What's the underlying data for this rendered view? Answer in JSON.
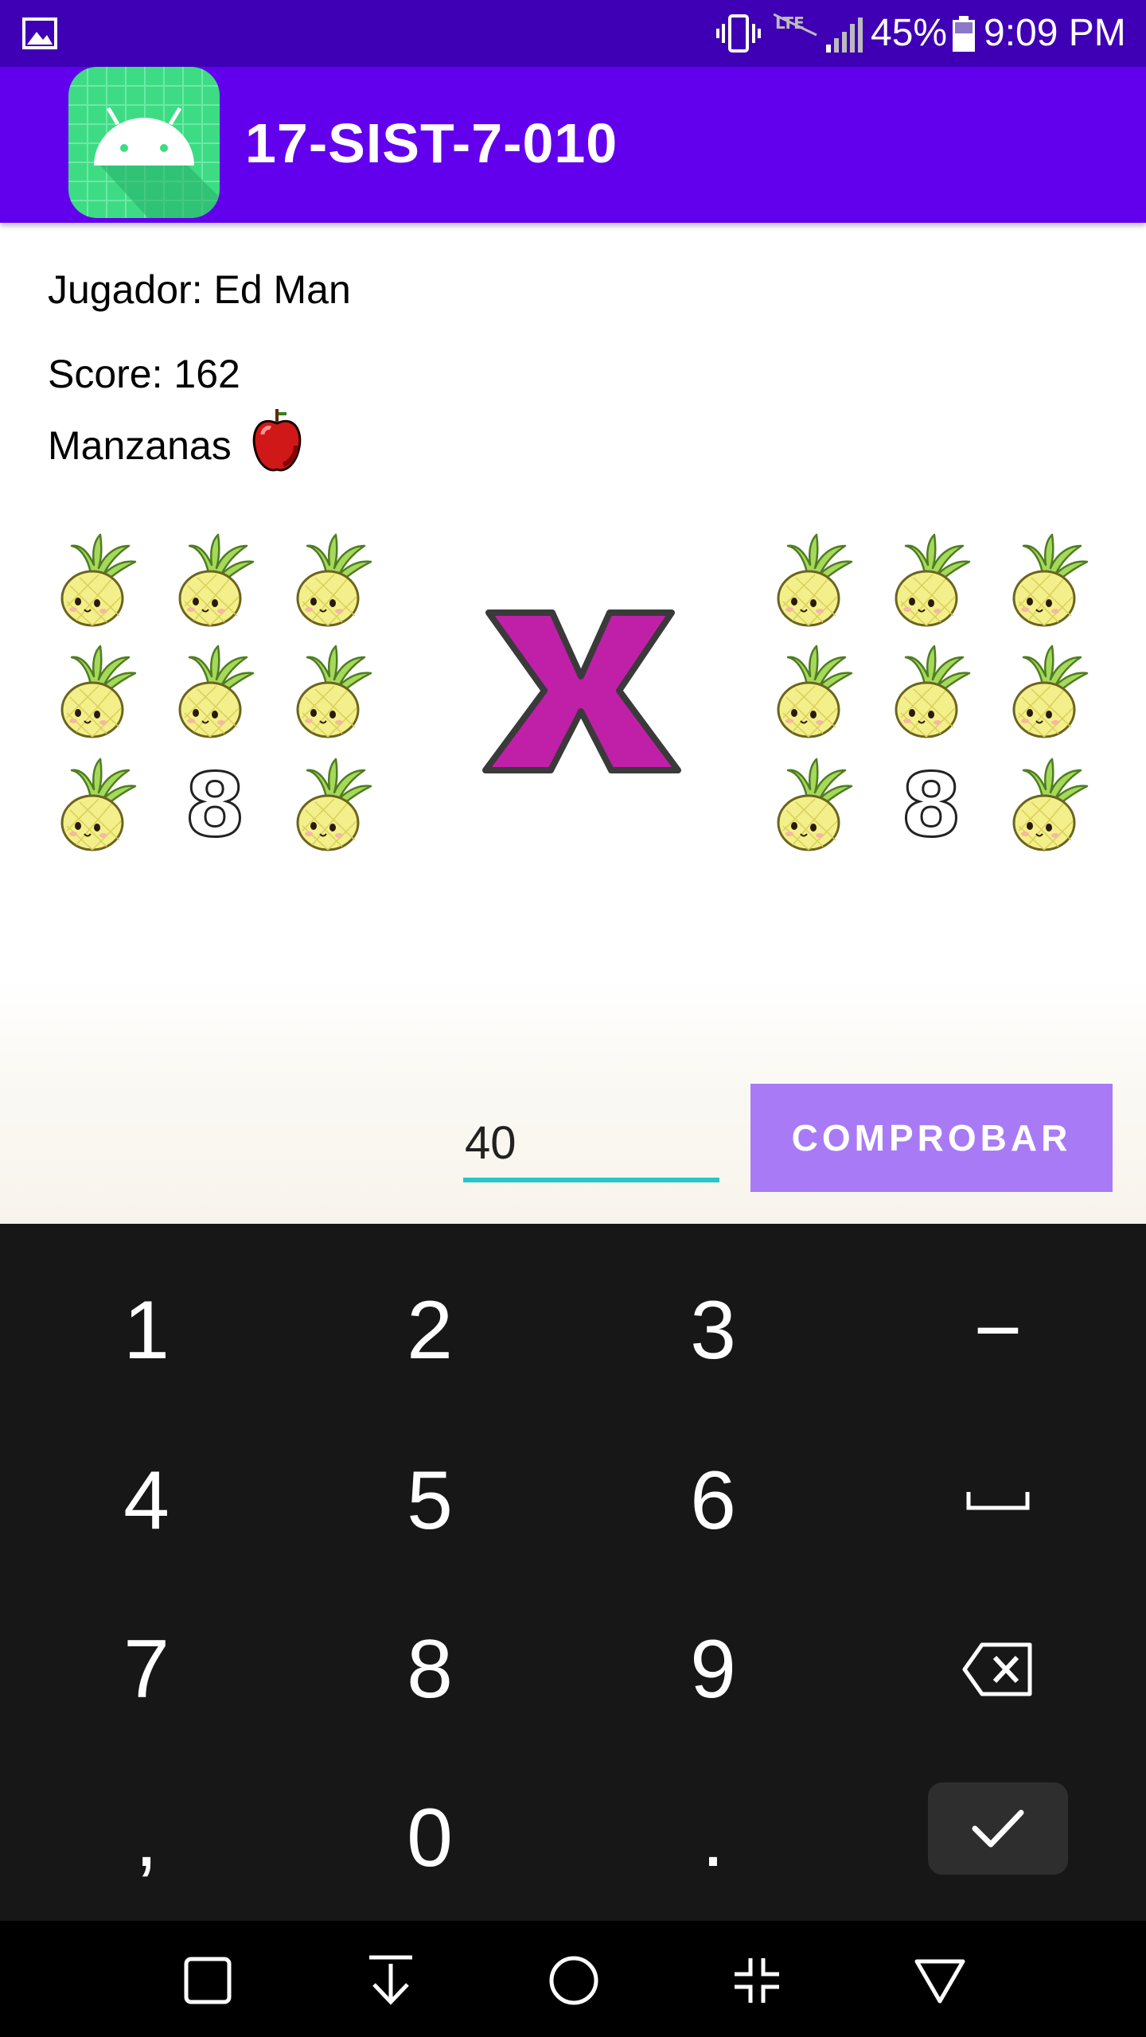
{
  "status_bar": {
    "battery_percent": "45%",
    "time": "9:09 PM",
    "icons": [
      "gallery-icon",
      "vibrate-icon",
      "lte-off-icon",
      "signal-icon",
      "battery-icon"
    ]
  },
  "app_bar": {
    "title": "17-SIST-7-010",
    "icon": "android-app-icon"
  },
  "game": {
    "player_label": "Jugador: Ed Man",
    "score_label": "Score: 162",
    "fruit_label": "Manzanas",
    "fruit_icon": "apple-icon",
    "left_group": {
      "cells": [
        "pineapple",
        "pineapple",
        "pineapple",
        "pineapple",
        "pineapple",
        "pineapple",
        "pineapple",
        "8",
        "pineapple"
      ]
    },
    "operator": "x",
    "right_group": {
      "cells": [
        "pineapple",
        "pineapple",
        "pineapple",
        "pineapple",
        "pineapple",
        "pineapple",
        "pineapple",
        "8",
        "pineapple"
      ]
    },
    "answer_value": "40",
    "check_label": "COMPROBAR"
  },
  "keyboard": {
    "rows": [
      [
        "1",
        "2",
        "3",
        "−"
      ],
      [
        "4",
        "5",
        "6",
        "space"
      ],
      [
        "7",
        "8",
        "9",
        "backspace"
      ],
      [
        ",",
        "0",
        ".",
        "enter"
      ]
    ]
  },
  "nav_bar": {
    "icons": [
      "recent-apps-icon",
      "download-icon",
      "home-icon",
      "fullscreen-exit-icon",
      "back-icon"
    ]
  },
  "colors": {
    "status_bar": "#3f00b5",
    "app_bar": "#6200ee",
    "button": "#a97af5",
    "input_underline": "#26c6c6",
    "keyboard": "#171717",
    "operator": "#c020a8"
  }
}
